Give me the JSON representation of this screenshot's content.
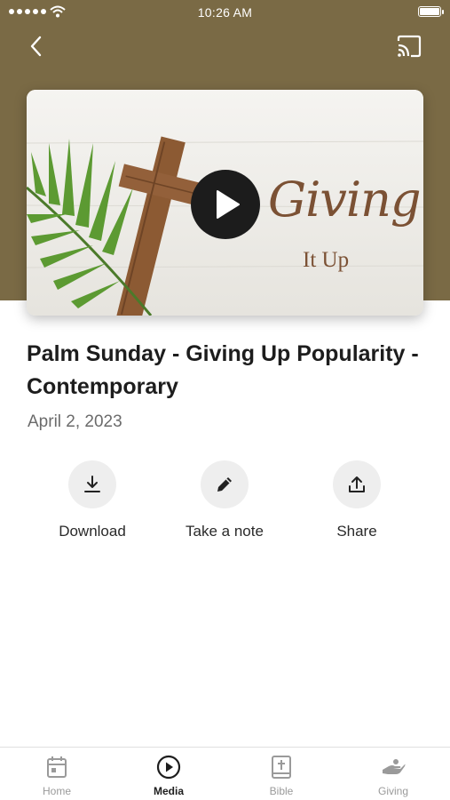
{
  "status_bar": {
    "time": "10:26 AM"
  },
  "header": {
    "back_icon": "chevron-left-icon",
    "cast_icon": "cast-icon"
  },
  "video": {
    "thumbnail_title": "Giving",
    "thumbnail_subtitle": "It Up",
    "play_icon": "play-icon"
  },
  "sermon": {
    "title": "Palm Sunday - Giving Up Popularity - Contemporary",
    "date": "April 2, 2023"
  },
  "actions": [
    {
      "label": "Download",
      "icon": "download-icon"
    },
    {
      "label": "Take a note",
      "icon": "pencil-icon"
    },
    {
      "label": "Share",
      "icon": "share-icon"
    }
  ],
  "tabs": [
    {
      "label": "Home",
      "icon": "calendar-icon",
      "active": false
    },
    {
      "label": "Media",
      "icon": "play-circle-icon",
      "active": true
    },
    {
      "label": "Bible",
      "icon": "bible-icon",
      "active": false
    },
    {
      "label": "Giving",
      "icon": "giving-hand-icon",
      "active": false
    }
  ],
  "colors": {
    "hero_background": "#7a6a45",
    "accent_text": "#7b5134"
  }
}
